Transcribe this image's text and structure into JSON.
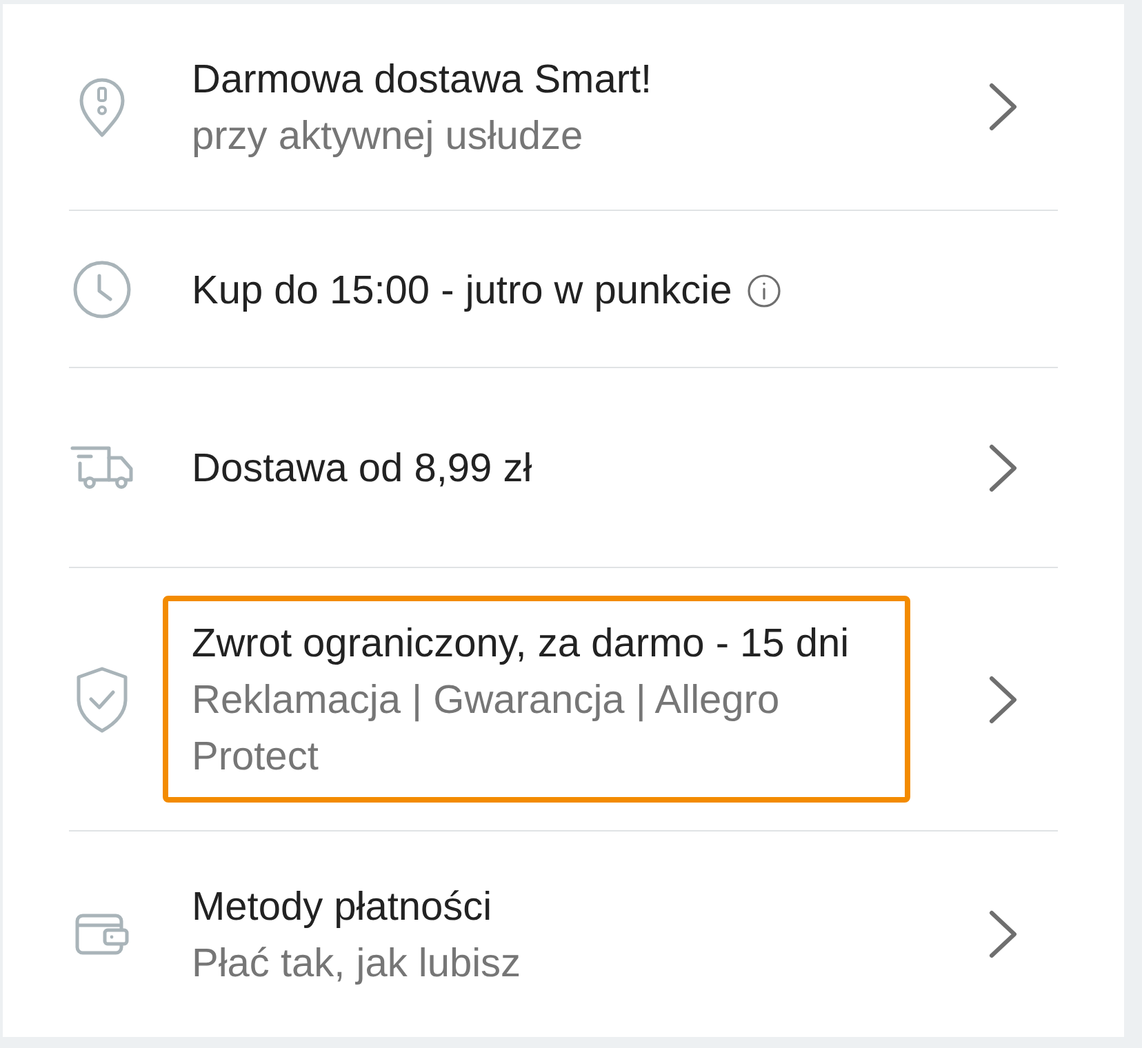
{
  "items": [
    {
      "title": "Darmowa dostawa Smart!",
      "subtitle": "przy aktywnej usłudze",
      "info": false,
      "chevron": true,
      "highlighted": false
    },
    {
      "title": "Kup do 15:00 - jutro w punkcie",
      "info": true,
      "chevron": false,
      "highlighted": false
    },
    {
      "title": "Dostawa od 8,99 zł",
      "info": false,
      "chevron": true,
      "highlighted": false
    },
    {
      "title": "Zwrot ograniczony, za darmo - 15 dni",
      "subtitle": "Reklamacja | Gwarancja | Allegro Protect",
      "info": false,
      "chevron": true,
      "highlighted": true
    },
    {
      "title": "Metody płatności",
      "subtitle": "Płać tak, jak lubisz",
      "info": false,
      "chevron": true,
      "highlighted": false
    }
  ]
}
